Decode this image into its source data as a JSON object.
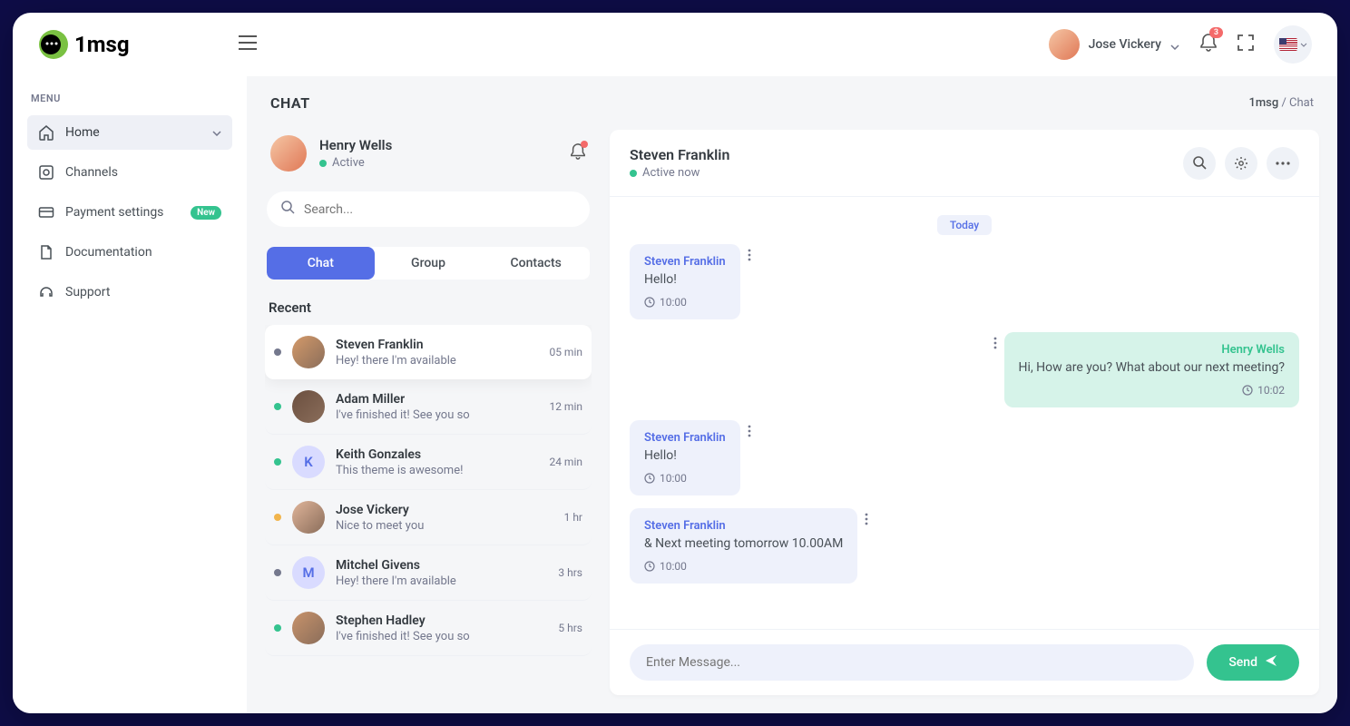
{
  "brand": "1msg",
  "topbar": {
    "user_name": "Jose Vickery",
    "notif_count": "3"
  },
  "sidebar": {
    "menu_label": "MENU",
    "items": [
      {
        "label": "Home",
        "active": true,
        "icon": "home",
        "chevron": true
      },
      {
        "label": "Channels",
        "icon": "cog"
      },
      {
        "label": "Payment settings",
        "icon": "card",
        "badge": "New"
      },
      {
        "label": "Documentation",
        "icon": "doc"
      },
      {
        "label": "Support",
        "icon": "headset"
      }
    ]
  },
  "page": {
    "title": "CHAT",
    "crumb_root": "1msg",
    "crumb_sep": " / ",
    "crumb_leaf": "Chat"
  },
  "chat_list": {
    "me_name": "Henry Wells",
    "me_status": "Active",
    "search_placeholder": "Search...",
    "tabs": [
      "Chat",
      "Group",
      "Contacts"
    ],
    "recent_label": "Recent",
    "items": [
      {
        "name": "Steven Franklin",
        "preview": "Hey! there I'm available",
        "time": "05 min",
        "status": "gray",
        "active": true,
        "avatar": "img",
        "avatarColor": "#d49a6a"
      },
      {
        "name": "Adam Miller",
        "preview": "I've finished it! See you so",
        "time": "12 min",
        "status": "green",
        "avatar": "img",
        "avatarColor": "#6b4f3f"
      },
      {
        "name": "Keith Gonzales",
        "preview": "This theme is awesome!",
        "time": "24 min",
        "status": "green",
        "avatar": "letter",
        "letter": "K",
        "avatarColor": "#d9dbff",
        "letterColor": "#556ee6"
      },
      {
        "name": "Jose Vickery",
        "preview": "Nice to meet you",
        "time": "1 hr",
        "status": "orange",
        "avatar": "img",
        "avatarColor": "#e0b59a"
      },
      {
        "name": "Mitchel Givens",
        "preview": "Hey! there I'm available",
        "time": "3 hrs",
        "status": "gray",
        "avatar": "letter",
        "letter": "M",
        "avatarColor": "#d9dbff",
        "letterColor": "#556ee6"
      },
      {
        "name": "Stephen Hadley",
        "preview": "I've finished it! See you so",
        "time": "5 hrs",
        "status": "green",
        "avatar": "img",
        "avatarColor": "#c8936b"
      }
    ]
  },
  "chat": {
    "peer_name": "Steven Franklin",
    "peer_status": "Active now",
    "day_label": "Today",
    "messages": [
      {
        "dir": "in",
        "sender": "Steven Franklin",
        "text": "Hello!",
        "time": "10:00"
      },
      {
        "dir": "out",
        "sender": "Henry Wells",
        "text": "Hi, How are you? What about our next meeting?",
        "time": "10:02"
      },
      {
        "dir": "in",
        "sender": "Steven Franklin",
        "text": "Hello!",
        "time": "10:00"
      },
      {
        "dir": "in",
        "sender": "Steven Franklin",
        "text": "& Next meeting tomorrow 10.00AM",
        "time": "10:00"
      }
    ],
    "composer_placeholder": "Enter Message...",
    "send_label": "Send"
  }
}
